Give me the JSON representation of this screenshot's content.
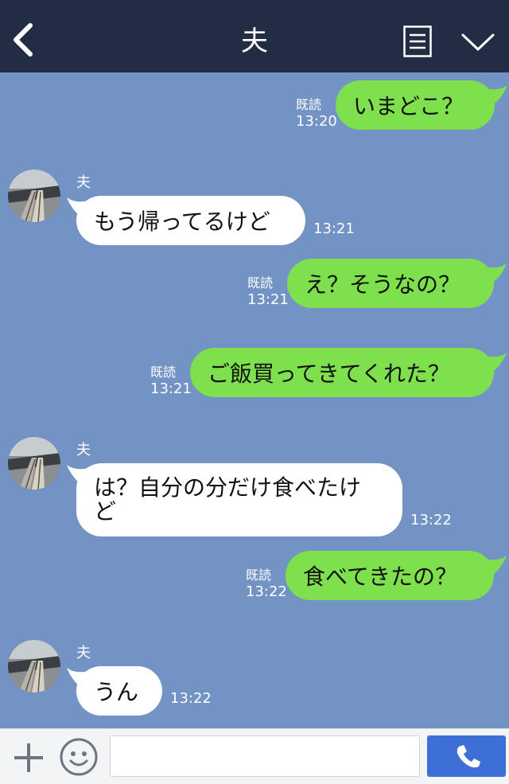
{
  "header": {
    "title": "夫"
  },
  "messages": [
    {
      "dir": "out",
      "text": "いまどこ？",
      "read": "既読",
      "time": "13:20"
    },
    {
      "dir": "in",
      "sender": "夫",
      "text": "もう帰ってるけど",
      "time": "13:21"
    },
    {
      "dir": "out",
      "text": "え？そうなの？",
      "read": "既読",
      "time": "13:21"
    },
    {
      "dir": "out",
      "text": "ご飯買ってきてくれた？",
      "read": "既読",
      "time": "13:21"
    },
    {
      "dir": "in",
      "sender": "夫",
      "text_line1": "は？自分の分だけ食べたけ",
      "text_line2": "ど",
      "time": "13:22"
    },
    {
      "dir": "out",
      "text": "食べてきたの？",
      "read": "既読",
      "time": "13:22"
    },
    {
      "dir": "in",
      "sender": "夫",
      "text": "うん",
      "time": "13:22"
    }
  ],
  "input": {
    "value": ""
  },
  "colors": {
    "header": "#222d45",
    "chat_bg": "#7493c5",
    "outgoing_bubble": "#7fe04e",
    "incoming_bubble": "#ffffff",
    "call_button": "#3e6fd6"
  },
  "icons": [
    "back-icon",
    "menu-icon",
    "chevron-down-icon",
    "plus-icon",
    "emoji-icon",
    "phone-icon"
  ]
}
